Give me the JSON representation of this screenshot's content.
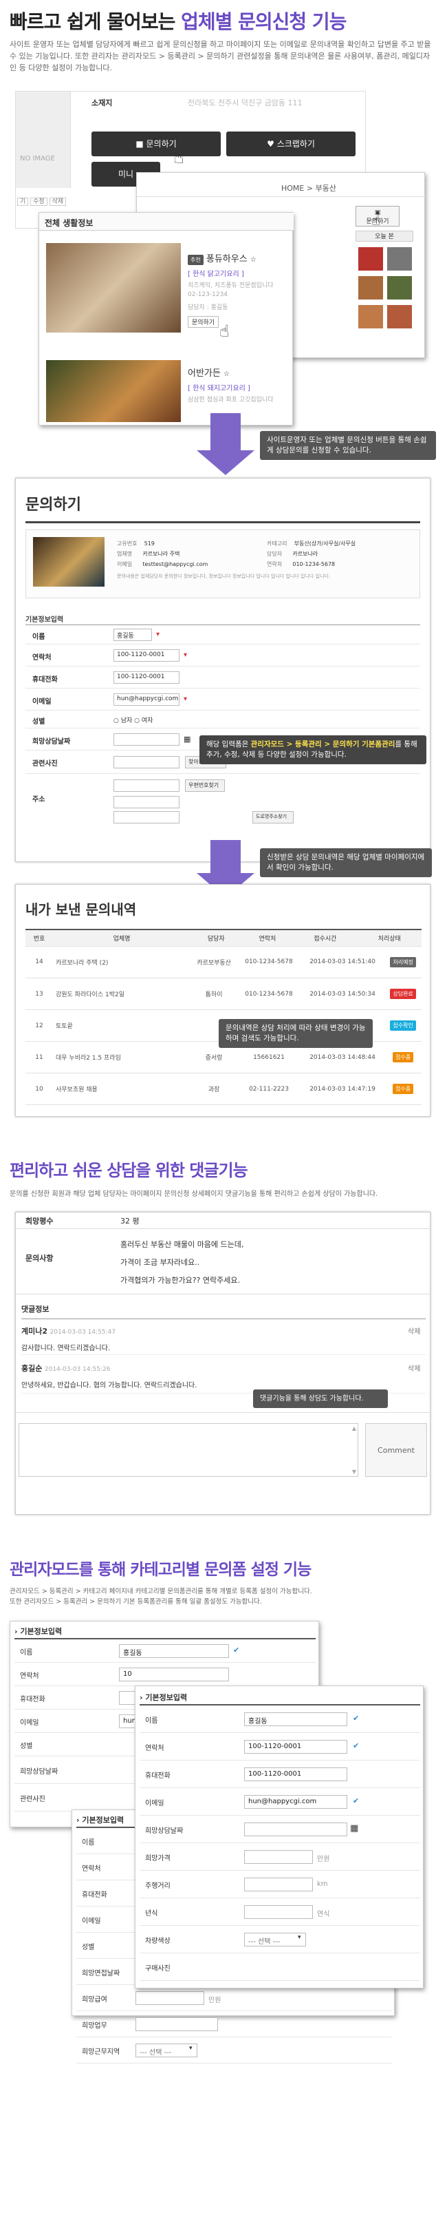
{
  "hero": {
    "title_prefix": "빠르고 쉽게 물어보는 ",
    "title_hl": "업체별 문의신청 기능",
    "desc": "사이트 운영자 또는 업체별 담당자에게 빠르고 쉽게 문의신청을 하고 마이페이지 또는 이메일로 문의내역을 확인하고 답변을 주고 받을 수 있는 기능입니다. 또한 관리자는 관리자모드 > 등록관리 > 문의하기 관련설정을 통해 문의내역은 물론 사용여부, 폼관리, 메일디자인 등 다양한 설정이 가능합니다."
  },
  "screen1": {
    "no_image": "NO IMAGE",
    "addr_label": "소재지",
    "addr_value": "전라북도 전주시 덕진구 금암동 111",
    "btn_inquiry": "문의하기",
    "btn_scrap": "스크랩하기",
    "btn_mini": "미니",
    "tags": [
      "기",
      "수정",
      "삭제"
    ],
    "breadcrumb": "HOME > 부동산",
    "right_btn": "문의하기",
    "right_btn2": "오늘 본",
    "popup_title": "전체 생활정보",
    "item1": {
      "badge": "추천",
      "name": "퐁듀하우스",
      "cat": "[ 한식 닭고기요리 ]",
      "addr": "치즈케익, 치즈퐁듀 전문점입니다",
      "tel": "02-123-1234",
      "owner": "담당자 : 홍길동",
      "btn": "문의하기"
    },
    "item2": {
      "name": "어반가든",
      "cat": "[ 한식 돼지고기요리 ]",
      "addr": "삼삼한 점심과 회포 고깃집입니다"
    }
  },
  "callout1": "사이트운영자 또는 업체별 문의신청 버튼을 통해 손쉽게 상담문의를 신청할 수 있습니다.",
  "screen2": {
    "title": "문의하기",
    "info": {
      "lbl_no": "고유번호",
      "val_no": "519",
      "lbl_name": "업체명",
      "val_name": "카르보나라 주택",
      "lbl_mail": "이메일",
      "val_mail": "testtest@happycgi.com",
      "lbl_cat": "카테고리",
      "val_cat": "부동산(상가/사무실/사무실",
      "lbl_mgr": "담당자",
      "val_mgr": "카르보나라",
      "lbl_tel": "연락처",
      "val_tel": "010-1234-5678",
      "note": "문의내용은 업체담당자 문의한다 정보입니다, 정보입니다 정보입니다 입니다 입니다 입니다 입니다 입니다."
    },
    "section": "기본정보입력",
    "rows": [
      {
        "label": "이름",
        "value": "홍길동"
      },
      {
        "label": "연락처",
        "value": "100-1120-0001"
      },
      {
        "label": "휴대전화",
        "value": "100-1120-0001"
      },
      {
        "label": "이메일",
        "value": "hun@happycgi.com"
      },
      {
        "label": "성별",
        "value": "○ 남자 ○ 여자"
      },
      {
        "label": "희망상담날짜",
        "value": ""
      },
      {
        "label": "관련사진",
        "value": "찾아보기..."
      },
      {
        "label": "주소",
        "value": "우편번호찾기"
      }
    ],
    "addr_btn2": "도로명주소찾기"
  },
  "callout2": {
    "pre": "해당 입력폼은 ",
    "hl": "관리자모드 > 등록관리 > 문의하기 기본폼관리",
    "post": "를 통해 추가, 수정, 삭제 등 다양한 설정이 가능합니다."
  },
  "callout3": "신청받은 상담 문의내역은 해당 업체별 마이페이지에서 확인이 가능합니다.",
  "screen3": {
    "title": "내가 보낸 문의내역",
    "headers": [
      "번호",
      "업체명",
      "담당자",
      "연락처",
      "접수시간",
      "처리상태"
    ],
    "rows": [
      {
        "no": "14",
        "name": "카르보나라 주택 (2)",
        "mgr": "카르보부동산",
        "tel": "010-1234-5678",
        "time": "2014-03-03 14:51:40",
        "status": "처리예정",
        "color": "#666666"
      },
      {
        "no": "13",
        "name": "강원도 파라다이스 1박2일",
        "mgr": "톰하이",
        "tel": "010-1234-5678",
        "time": "2014-03-03 14:50:34",
        "status": "상담완료",
        "color": "#e03131"
      },
      {
        "no": "12",
        "name": "토토끝",
        "mgr": "",
        "tel": "",
        "time": "",
        "status": "접수확인",
        "color": "#1aaedc"
      },
      {
        "no": "11",
        "name": "대우 누비라2 1.5 프라임",
        "mgr": "중서랑",
        "tel": "15661621",
        "time": "2014-03-03 14:48:44",
        "status": "접수중",
        "color": "#f08c00"
      },
      {
        "no": "10",
        "name": "사무보조원 채용",
        "mgr": "과장",
        "tel": "02-111-2223",
        "time": "2014-03-03 14:47:19",
        "status": "접수중",
        "color": "#f08c00"
      }
    ]
  },
  "callout4": "문의내역은 상담 처리에 따라 상태 변경이 가능하며 검색도 가능합니다.",
  "comments": {
    "title": "편리하고 쉬운 상담을 위한 댓글기능",
    "desc": "문의를 신청한 회원과 해당 업체 담당자는 마이페이지 문의신청 상세페이지 댓글기능을 통해 편리하고 손쉽게 상담이 가능합니다.",
    "lbl_area": "희망평수",
    "val_area": "32 평",
    "lbl_msg": "문의사항",
    "msg_lines": [
      "홈러두신 부동산 매물이 마음에 드는데,",
      "가격이 조금 부자라네요..",
      "가격협의가 가능한가요?? 연락주세요."
    ],
    "section": "댓글정보",
    "c1": {
      "name": "계미나2",
      "date": "2014-03-03 14:55:47",
      "text": "감사합니다. 연락드리겠습니다.",
      "del": "삭제"
    },
    "c2": {
      "name": "홍길순",
      "date": "2014-03-03 14:55:26",
      "text": "안녕하세요, 반갑습니다. 협의 가능합니다. 연락드리겠습니다.",
      "del": "삭제"
    },
    "btn": "Comment"
  },
  "callout5": "댓글기능을 통해 상담도 가능합니다.",
  "admin": {
    "title": "관리자모드를 통해 카테고리별 문의폼 설정 기능",
    "desc1": "관리자모드 > 등록관리 > 카테고리 페이지내 카테고리별 문의폼관리를 통해 개별로 등록폼 설정이 가능합니다.",
    "desc2": "또한 관리자모드 > 등록관리 > 문의하기 기본 등록폼관리를 통해 일괄 폼설정도 가능합니다.",
    "section": "기본정보입력",
    "f1": [
      "이름",
      "연락처",
      "휴대전화",
      "이메일",
      "성별",
      "희망상담날짜",
      "관련사진"
    ],
    "f1_name": "홍길동",
    "f1_tel": "10",
    "f1_mail": "hun",
    "f2": [
      "이름",
      "연락처",
      "휴대전화",
      "이메일",
      "희망상담날짜",
      "희망가격",
      "주행거리",
      "년식",
      "차량색상",
      "구매사진"
    ],
    "f2_vals": {
      "name": "홍길동",
      "tel": "100-1120-0001",
      "hp": "100-1120-0001",
      "mail": "hun@happycgi.com",
      "u_price": "만원",
      "u_km": "km",
      "u_year": "연식",
      "color": "--- 선택 ---"
    },
    "f3": [
      "이름",
      "연락처",
      "휴대전화",
      "이메일",
      "성별",
      "희망면접날짜",
      "희망급여",
      "희망업무",
      "희망근무지역"
    ],
    "f3_unit": "만원",
    "f3_sel": "--- 선택 ---"
  }
}
